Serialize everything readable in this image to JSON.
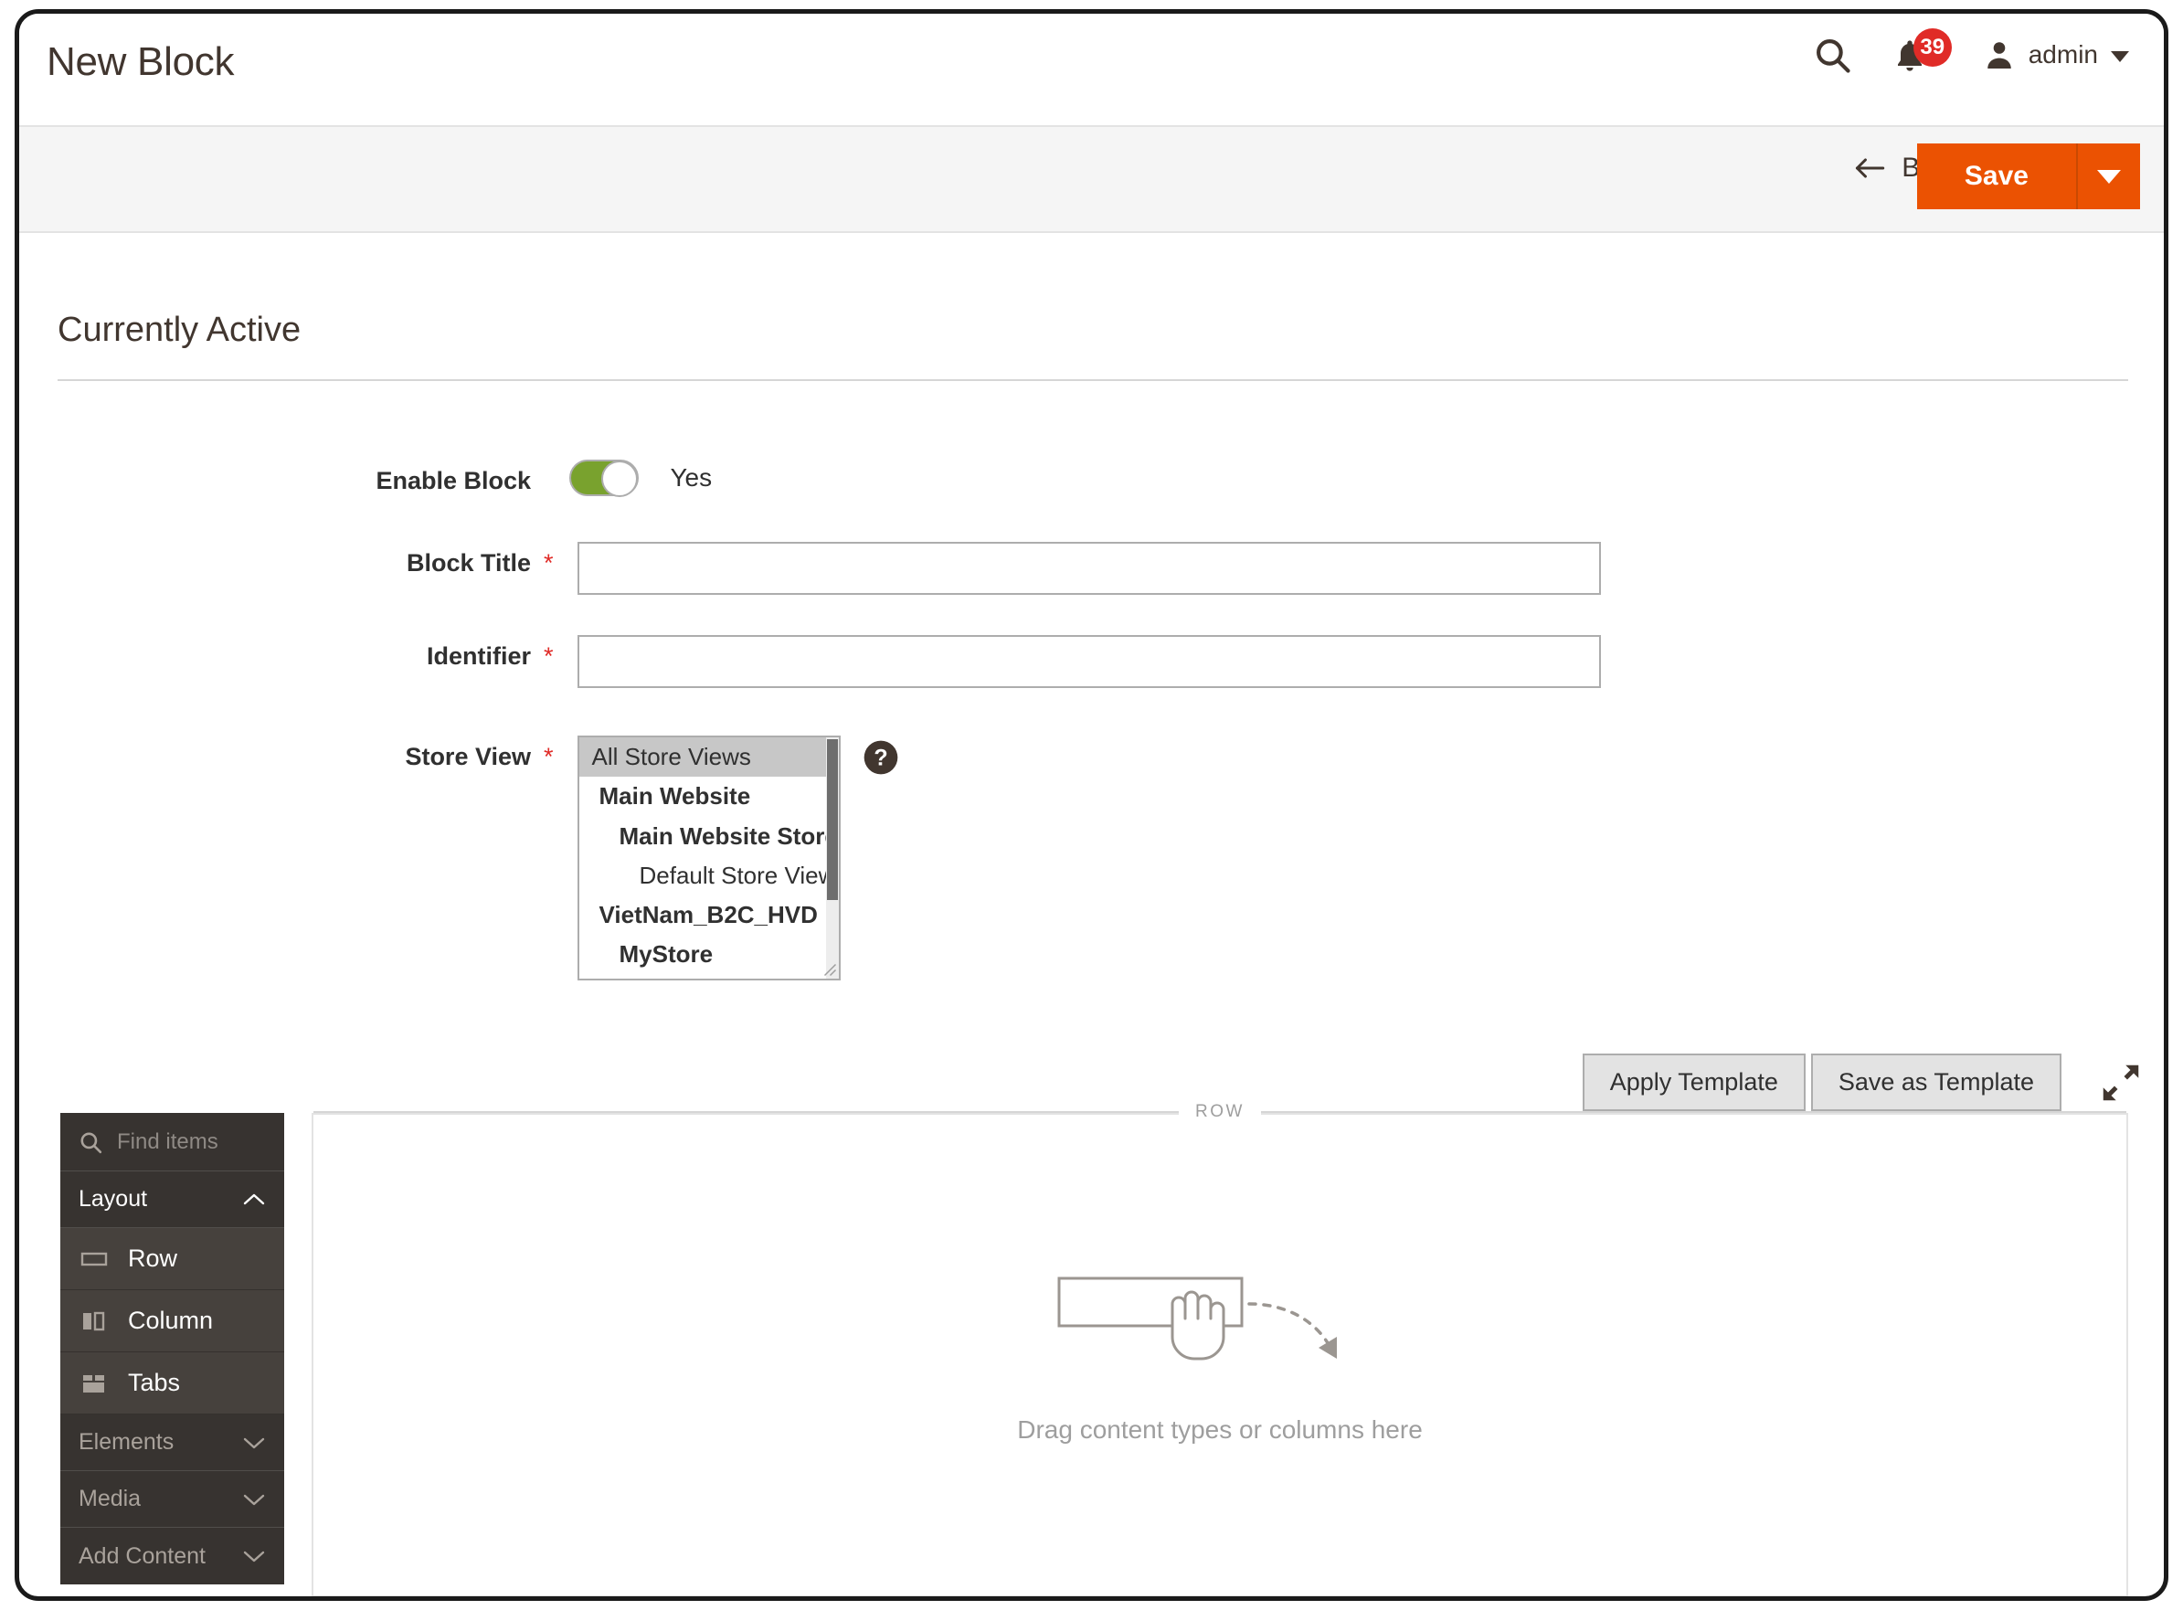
{
  "header": {
    "title": "New Block",
    "search_icon": "search-icon",
    "bell_icon": "bell-icon",
    "notification_count": "39",
    "user_icon": "user-avatar-icon",
    "admin_label": "admin",
    "caret_icon": "chevron-down-icon"
  },
  "toolbar": {
    "back_label": "Back",
    "back_icon": "arrow-left-icon",
    "save_label": "Save",
    "save_split_icon": "chevron-down-icon",
    "save_color": "#eb5202"
  },
  "section": {
    "title": "Currently Active"
  },
  "form": {
    "enable_block": {
      "label": "Enable Block",
      "value": "Yes",
      "toggled": true,
      "toggle_color": "#79a22e"
    },
    "block_title": {
      "label": "Block Title",
      "required": "*",
      "value": "",
      "placeholder": ""
    },
    "identifier": {
      "label": "Identifier",
      "required": "*",
      "value": "",
      "placeholder": ""
    },
    "store_view": {
      "label": "Store View",
      "required": "*",
      "help_icon": "help-circle-icon",
      "options": [
        {
          "label": "All Store Views",
          "level": 0,
          "selected": true
        },
        {
          "label": "Main Website",
          "level": 1,
          "selected": false
        },
        {
          "label": "Main Website Store",
          "level": 2,
          "selected": false
        },
        {
          "label": "Default Store View",
          "level": 3,
          "selected": false
        },
        {
          "label": "VietNam_B2C_HVD",
          "level": 1,
          "selected": false
        },
        {
          "label": "MyStore",
          "level": 2,
          "selected": false
        }
      ]
    }
  },
  "templates": {
    "apply_label": "Apply Template",
    "save_as_label": "Save as Template",
    "expand_icon": "fullscreen-expand-icon"
  },
  "page_builder": {
    "search_placeholder": "Find items",
    "search_icon": "search-icon",
    "panels": [
      {
        "label": "Layout",
        "expanded": true,
        "chevron": "chevron-up-icon",
        "items": [
          {
            "label": "Row",
            "icon": "row-icon"
          },
          {
            "label": "Column",
            "icon": "column-icon"
          },
          {
            "label": "Tabs",
            "icon": "tabs-icon"
          }
        ]
      },
      {
        "label": "Elements",
        "expanded": false,
        "chevron": "chevron-down-icon",
        "items": []
      },
      {
        "label": "Media",
        "expanded": false,
        "chevron": "chevron-down-icon",
        "items": []
      },
      {
        "label": "Add Content",
        "expanded": false,
        "chevron": "chevron-down-icon",
        "items": []
      }
    ],
    "canvas": {
      "row_tag": "ROW",
      "drop_text": "Drag content types or columns here",
      "drag_icon": "drag-hand-illustration"
    }
  }
}
